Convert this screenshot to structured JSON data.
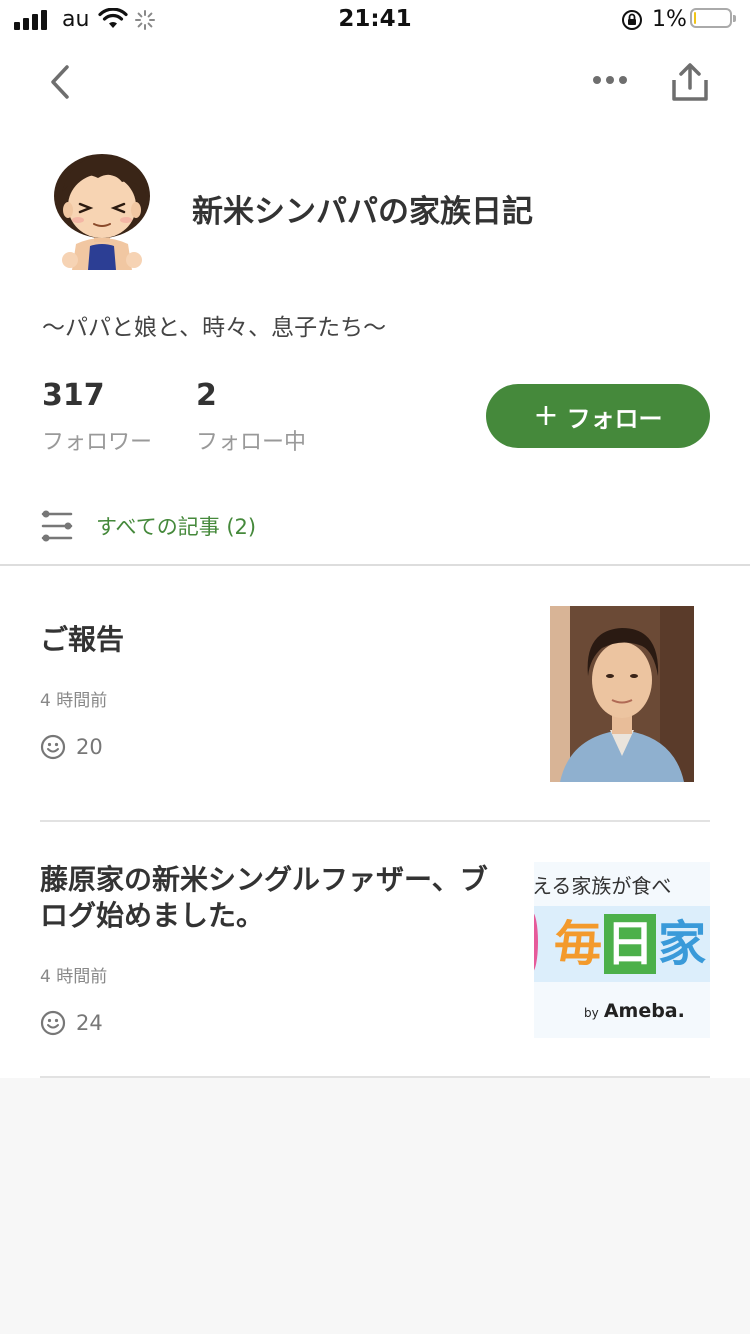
{
  "status_bar": {
    "carrier": "au",
    "time": "21:41",
    "battery_percent": "1%",
    "battery_level": 0.05
  },
  "nav": {
    "back_icon": "chevron-left-icon",
    "more_icon": "ellipsis-icon",
    "share_icon": "share-icon"
  },
  "profile": {
    "blog_title": "新米シンパパの家族日記",
    "description": "〜パパと娘と、時々、息子たち〜",
    "followers_count": "317",
    "followers_label": "フォロワー",
    "following_count": "2",
    "following_label": "フォロー中",
    "follow_button_label": "フォロー",
    "follow_button_icon": "+"
  },
  "filter": {
    "label": "すべての記事 (2)",
    "icon": "filter-sliders-icon"
  },
  "articles": [
    {
      "title": "ご報告",
      "time": "4 時間前",
      "likes": "20",
      "thumbnail": "portrait-photo"
    },
    {
      "title": "藤原家の新米シングルファザー、ブログ始めました。",
      "time": "4 時間前",
      "likes": "24",
      "thumbnail": "banner-image",
      "thumbnail_text": {
        "top": "える家族が食べ",
        "main_1": "毎",
        "main_2": "日",
        "main_3": "家",
        "brand_by": "by",
        "brand": "Ameba."
      }
    }
  ],
  "colors": {
    "accent_green": "#45893b",
    "background": "#f7f7f7"
  }
}
